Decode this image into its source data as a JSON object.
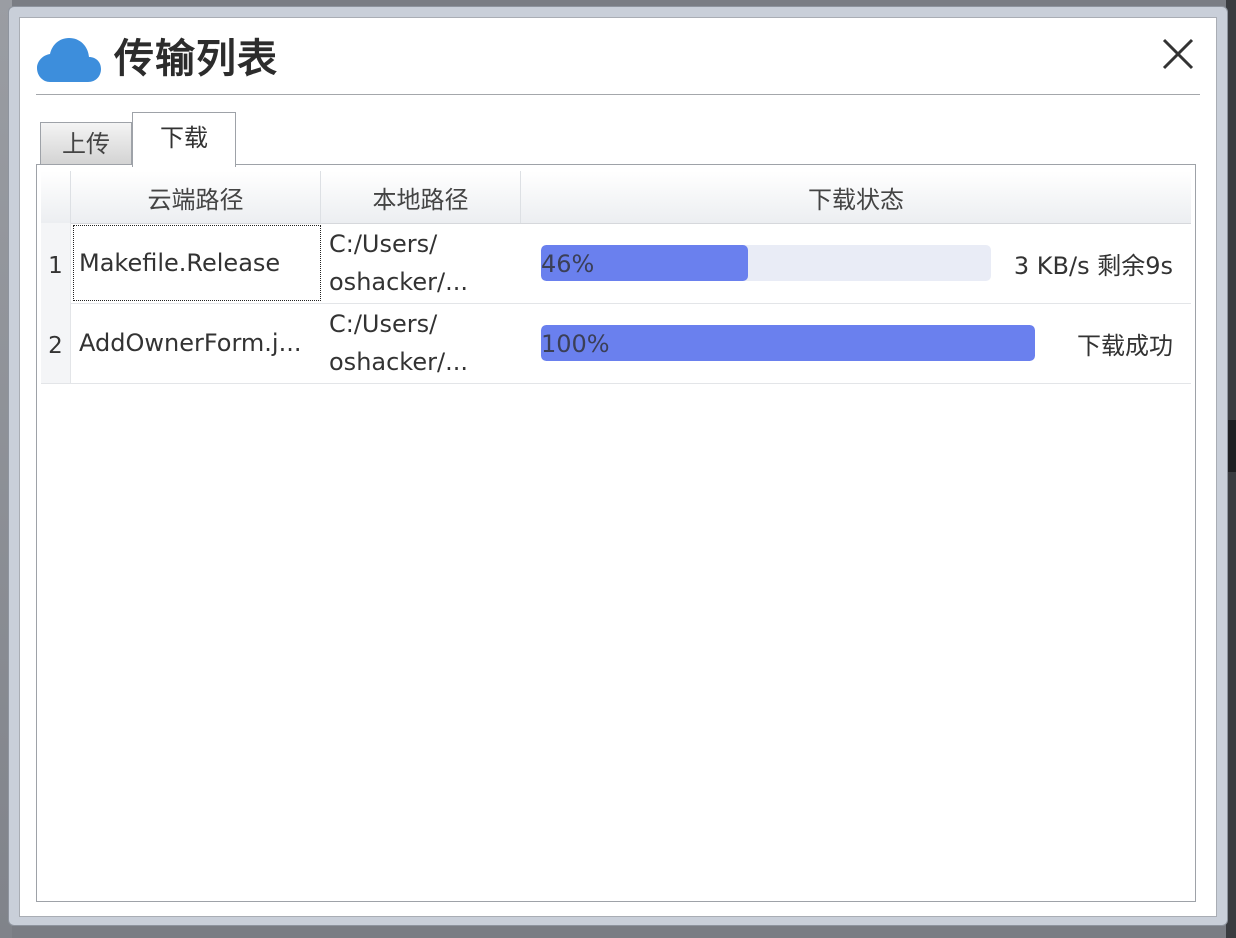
{
  "window": {
    "title": "传输列表",
    "accent_color": "#3d8edc",
    "icon": "cloud-icon",
    "close_icon": "close-icon"
  },
  "tabs": [
    {
      "label": "上传",
      "active": false
    },
    {
      "label": "下载",
      "active": true
    }
  ],
  "table": {
    "columns": [
      "云端路径",
      "本地路径",
      "下载状态"
    ],
    "rows": [
      {
        "index": "1",
        "cloud_path": "Makefile.Release",
        "local_path_line1": "C:/Users/",
        "local_path_line2": "oshacker/...",
        "progress": 46,
        "progress_label": "46%",
        "status": "3 KB/s  剩余9s",
        "focused": true
      },
      {
        "index": "2",
        "cloud_path": "AddOwnerForm.j...",
        "local_path_line1": "C:/Users/",
        "local_path_line2": "oshacker/...",
        "progress": 100,
        "progress_label": "100%",
        "status": "下载成功",
        "focused": false
      }
    ]
  },
  "colors": {
    "progress_fill": "#6a80ee",
    "progress_track": "#e9ecf6"
  }
}
